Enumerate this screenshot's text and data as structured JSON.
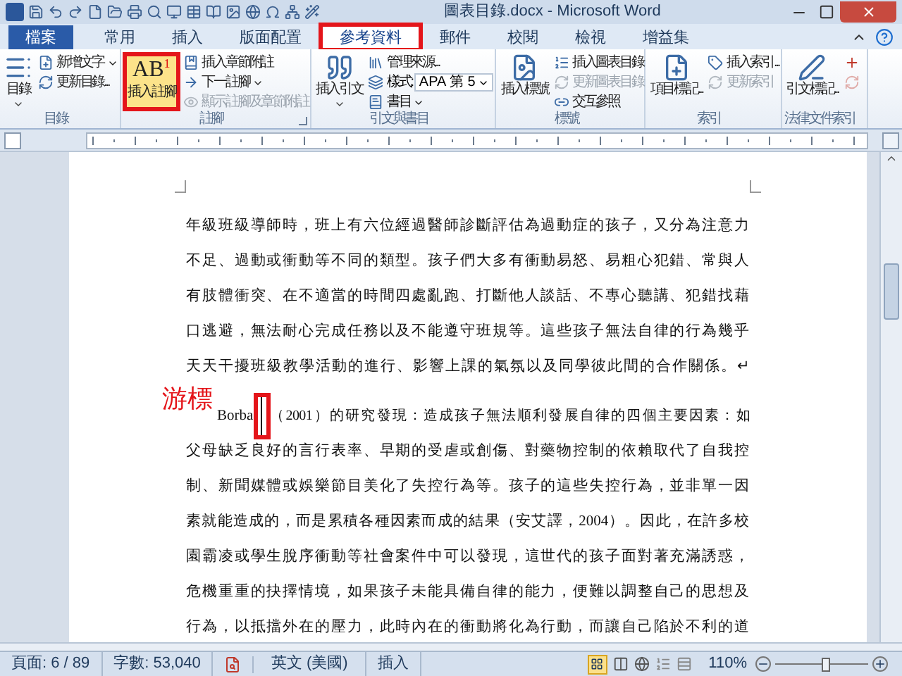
{
  "window": {
    "title": "圖表目錄.docx - Microsoft Word"
  },
  "tabs": [
    {
      "label": "檔案",
      "kind": "file",
      "selected": false,
      "highlighted": false
    },
    {
      "label": "常用",
      "kind": "tab",
      "selected": false,
      "highlighted": false
    },
    {
      "label": "插入",
      "kind": "tab",
      "selected": false,
      "highlighted": false
    },
    {
      "label": "版面配置",
      "kind": "tab",
      "selected": false,
      "highlighted": false
    },
    {
      "label": "參考資料",
      "kind": "tab",
      "selected": true,
      "highlighted": true
    },
    {
      "label": "郵件",
      "kind": "tab",
      "selected": false,
      "highlighted": false
    },
    {
      "label": "校閱",
      "kind": "tab",
      "selected": false,
      "highlighted": false
    },
    {
      "label": "檢視",
      "kind": "tab",
      "selected": false,
      "highlighted": false
    },
    {
      "label": "增益集",
      "kind": "tab",
      "selected": false,
      "highlighted": false
    }
  ],
  "ribbon": {
    "groups": [
      {
        "label": "目錄",
        "launcher": false,
        "large": [
          {
            "label": "目錄",
            "dropdown": true,
            "highlighted": false
          }
        ],
        "small": [
          {
            "kind": "button",
            "label": "新增文字",
            "dropdown": true,
            "disabled": false
          },
          {
            "kind": "button",
            "label": "更新目錄...",
            "dropdown": false,
            "disabled": false
          }
        ]
      },
      {
        "label": "註腳",
        "launcher": true,
        "large": [
          {
            "label": "插入註腳",
            "icon_text": "AB",
            "icon_sup": "1",
            "dropdown": false,
            "highlighted": true
          }
        ],
        "small": [
          {
            "kind": "button",
            "label": "插入章節附註",
            "dropdown": false,
            "disabled": false
          },
          {
            "kind": "button",
            "label": "下一註腳",
            "dropdown": true,
            "disabled": false
          },
          {
            "kind": "button",
            "label": "顯示註腳及章節附註",
            "dropdown": false,
            "disabled": true
          }
        ]
      },
      {
        "label": "引文與書目",
        "launcher": false,
        "large": [
          {
            "label": "插入引文",
            "dropdown": true,
            "highlighted": false
          }
        ],
        "small": [
          {
            "kind": "button",
            "label": "管理來源...",
            "dropdown": false,
            "disabled": false
          },
          {
            "kind": "select",
            "label": "樣式:",
            "value": "APA 第 5"
          },
          {
            "kind": "button",
            "label": "書目",
            "dropdown": true,
            "disabled": false
          }
        ]
      },
      {
        "label": "標號",
        "launcher": false,
        "large": [
          {
            "label": "插入標號",
            "dropdown": false,
            "highlighted": false
          }
        ],
        "small": [
          {
            "kind": "button",
            "label": "插入圖表目錄",
            "dropdown": false,
            "disabled": false
          },
          {
            "kind": "button",
            "label": "更新圖表目錄",
            "dropdown": false,
            "disabled": true
          },
          {
            "kind": "button",
            "label": "交互參照",
            "dropdown": false,
            "disabled": false
          }
        ]
      },
      {
        "label": "索引",
        "launcher": false,
        "large": [
          {
            "label": "項目標記...",
            "dropdown": false,
            "highlighted": false
          }
        ],
        "small": [
          {
            "kind": "button",
            "label": "插入索引...",
            "dropdown": false,
            "disabled": false
          },
          {
            "kind": "button",
            "label": "更新索引",
            "dropdown": false,
            "disabled": true
          }
        ]
      },
      {
        "label": "法律文件索引",
        "launcher": false,
        "large": [
          {
            "label": "引文標記...",
            "dropdown": false,
            "highlighted": false
          }
        ],
        "small": [
          {
            "kind": "icon",
            "disabled": false
          },
          {
            "kind": "icon",
            "disabled": true
          }
        ]
      }
    ]
  },
  "document": {
    "paragraphs": [
      {
        "lines": [
          "年級班級導師時，班上有六位經過醫師診斷評估為過動症的孩子，又分為注意力",
          "不足、過動或衝動等不同的類型。孩子們大多有衝動易怒、易粗心犯錯、常與人",
          "有肢體衝突、在不適當的時間四處亂跑、打斷他人談話、不專心聽講、犯錯找藉",
          "口逃避，無法耐心完成任務以及不能遵守班規等。這些孩子無法自律的行為幾乎",
          "天天干擾班級教學活動的進行、影響上課的氣氛以及同學彼此間的合作關係。↵"
        ]
      },
      {
        "first_line": {
          "before": "Borba",
          "after": "（2001）的研究發現：造成孩子無法順利發展自律的四個主要因素：如"
        },
        "cursor_label": "游標",
        "lines": [
          "父母缺乏良好的言行表率、早期的受虐或創傷、對藥物控制的依賴取代了自我控",
          "制、新聞媒體或娛樂節目美化了失控行為等。孩子的這些失控行為，並非單一因",
          "素就能造成的，而是累積各種因素而成的結果（安艾譯，2004）。因此，在許多校",
          "園霸凌或學生脫序衝動等社會案件中可以發現，這世代的孩子面對著充滿誘惑，",
          "危機重重的抉擇情境，如果孩子未能具備自律的能力，便難以調整自己的思想及",
          "行為，以抵擋外在的壓力，此時內在的衝動將化為行動，而讓自己陷於不利的道"
        ]
      }
    ]
  },
  "status_bar": {
    "page": "頁面: 6 / 89",
    "words": "字數: 53,040",
    "language": "英文 (美國)",
    "mode": "插入",
    "zoom": "110%",
    "zoom_slider": {
      "level": 0.55
    }
  }
}
